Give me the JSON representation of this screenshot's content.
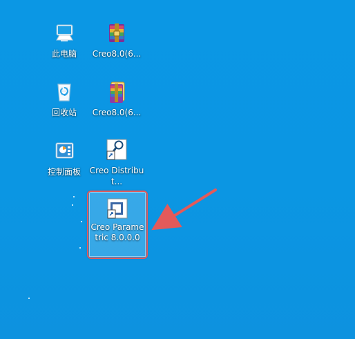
{
  "desktop": {
    "background": "#0b97e4",
    "icons": [
      {
        "label": "此电脑"
      },
      {
        "label": "Creo8.0(6..."
      },
      {
        "label": "回收站"
      },
      {
        "label": "Creo8.0(6..."
      },
      {
        "label": "控制面板"
      },
      {
        "label": "Creo Distribut..."
      },
      {
        "label": "Creo Parametric 8.0.0.0"
      }
    ],
    "annotation": {
      "box_color": "#e35a5a",
      "arrow_color": "#e35a5a"
    }
  }
}
